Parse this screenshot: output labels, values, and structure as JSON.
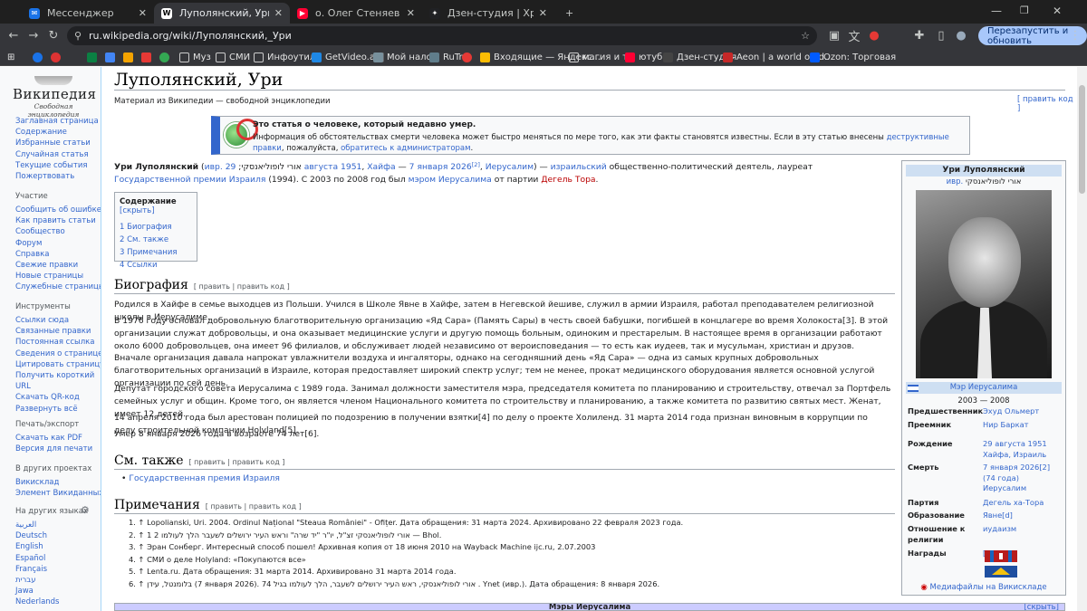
{
  "browser": {
    "tabs": [
      {
        "title": "Мессенджер",
        "favicon_color": "#1a73e8",
        "favicon": "✉"
      },
      {
        "title": "Луполянский, Ури — Википедия",
        "favicon_color": "#ffffff",
        "favicon": "W",
        "active": true
      },
      {
        "title": "о. Олег Стеняев о пятидесятниках",
        "favicon_color": "#ff0033",
        "favicon": "▶"
      },
      {
        "title": "Дзен-студия | Хроники цитадели",
        "favicon_color": "#202124",
        "favicon": "✦"
      }
    ],
    "new_tab": "+",
    "url": "ru.wikipedia.org/wiki/Луполянский,_Ури",
    "relaunch": "Перезапустить и обновить",
    "bookmarks": [
      "Муз",
      "СМИ",
      "Инфоутиль",
      "GetVideo.at |",
      "Мой налог",
      "RuTr",
      "Входящие — Яндекс...",
      "магия и тд",
      "ютуб",
      "Дзен-студия",
      "Aeon | a world of id...",
      "Ozon: Торговая"
    ]
  },
  "sidebar": {
    "logo_name": "Википедия",
    "logo_tag": "Свободная энциклопедия",
    "main": [
      "Заглавная страница",
      "Содержание",
      "Избранные статьи",
      "Случайная статья",
      "Текущие события",
      "Пожертвовать"
    ],
    "participation_h": "Участие",
    "participation": [
      "Сообщить об ошибке",
      "Как править статьи",
      "Сообщество",
      "Форум",
      "Справка",
      "Свежие правки",
      "Новые страницы",
      "Служебные страницы"
    ],
    "tools_h": "Инструменты",
    "tools": [
      "Ссылки сюда",
      "Связанные правки",
      "Постоянная ссылка",
      "Сведения о странице",
      "Цитировать страницу",
      "Получить короткий",
      "URL",
      "Скачать QR-код",
      "Развернуть всё"
    ],
    "print_h": "Печать/экспорт",
    "print": [
      "Скачать как PDF",
      "Версия для печати"
    ],
    "projects_h": "В других проектах",
    "projects": [
      "Викисклад",
      "Элемент Викиданных"
    ],
    "langs_h": "На других языках",
    "langs": [
      "العربية",
      "Deutsch",
      "English",
      "Español",
      "Français",
      "עברית",
      "Jawa",
      "Nederlands"
    ]
  },
  "article": {
    "title": "Луполянский, Ури",
    "sitesub": "Материал из Википедии — свободной энциклопедии",
    "edit_code": "[ править код ]",
    "ambox_title": "Это статья о человеке, который недавно умер.",
    "ambox_text_a": "Информация об обстоятельствах смерти человека может быстро меняться по мере того, как эти факты становятся известны. Если в эту статью внесены ",
    "ambox_link1": "деструктивные правки",
    "ambox_text_b": ", пожалуйста, ",
    "ambox_link2": "обратитесь к администраторам",
    "ambox_text_c": ".",
    "lead": {
      "name": "Ури Луполянский",
      "p1": " (",
      "heb_link": "ивр.",
      "heb": " אורי לופוליאנסקי",
      "p2": "; ",
      "born": "29 августа 1951",
      "p3": ", ",
      "haifa": "Хайфа",
      "p4": " — ",
      "died": "7 января 2026",
      "ref2": "[2]",
      "p5": ", ",
      "jer": "Иерусалим",
      "p6": ") — ",
      "isr": "израильский",
      "p7": " общественно-политический деятель, лауреат ",
      "prize": "Государственной премии Израиля",
      "p8": " (1994). С 2003 по 2008 год был ",
      "mayor": "мэром Иерусалима",
      "p9": " от партии ",
      "party": "Дегель Тора",
      "p10": "."
    },
    "toc": {
      "title": "Содержание",
      "hide": "[скрыть]",
      "items": [
        "1 Биография",
        "2 См. также",
        "3 Примечания",
        "4 Ссылки"
      ]
    },
    "bio_h": "Биография",
    "edit": "[ править | править код ]",
    "bio1": "Родился в Хайфе в семье выходцев из Польши. Учился в Школе Явне в Хайфе, затем в Негевской йешиве, служил в армии Израиля, работал преподавателем религиозной школы в Иерусалиме.",
    "bio2": "В 1976 году основал добровольную благотворительную организацию «Яд Сара» (Память Сары) в честь своей бабушки, погибшей в концлагере во время Холокоста[3]. В этой организации служат добровольцы, и она оказывает медицинские услуги и другую помощь больным, одиноким и престарелым. В настоящее время в организации работают около 6000 добровольцев, она имеет 96 филиалов, и обслуживает людей независимо от вероисповедания — то есть как иудеев, так и мусульман, христиан и друзов. Вначале организация давала напрокат увлажнители воздуха и ингаляторы, однако на сегодняшний день «Яд Сара» — одна из самых крупных добровольных благотворительных организаций в Израиле, которая предоставляет широкий спектр услуг; тем не менее, прокат медицинского оборудования является основной услугой организации по сей день.",
    "bio3": "Депутат городского совета Иерусалима с 1989 года. Занимал должности заместителя мэра, председателя комитета по планированию и строительству, отвечал за Портфель семейных услуг и общин. Кроме того, он является членом Национального комитета по строительству и планированию, а также комитета по развитию святых мест. Женат, имеет 12 детей.",
    "bio4": "14 апреля 2010 года был арестован полицией по подозрению в получении взятки[4] по делу о проекте Холиленд. 31 марта 2014 года признан виновным в коррупции по делу строительной компании Holyland[5].",
    "bio5": "Умер 8 января 2026 года в возрасте 74 лет[6].",
    "see_h": "См. также",
    "see_item": "Государственная премия Израиля",
    "notes_h": "Примечания",
    "refs": [
      "1. ↑ Lopolianski, Uri. 2004. Ordinul Național \"Steaua României\" - Ofițer. Дата обращения: 31 марта 2024. Архивировано 22 февраля 2023 года.",
      "2. ↑ 1 2 אורי לופוליאנסקי זצ\"ל, יו\"ר \"יד שרה\" וראש העיר ירושלים לשעבר הלך לעולמו — Bhol.",
      "3. ↑ Эран Сонберг. Интересный способ пошел! Архивная копия от 18 июня 2010 на Wayback Machine ijc.ru, 2.07.2003",
      "4. ↑ СМИ о деле Holyland: «Покупаются все»",
      "5. ↑ Lenta.ru. Дата обращения: 31 марта 2014. Архивировано 31 марта 2014 года.",
      "6. ↑ בלומנטל, עידן (7 января 2026). 74 אורי לופוליאנסקי, ראש העיר ירושלים לשעבר, הלך לעולמו בגיל . Ynet (ивр.). Дата обращения: 8 января 2026."
    ],
    "nav_bottom": "Мэры Иерусалима",
    "nav_hide": "[скрыть]"
  },
  "infobox": {
    "title": "Ури Луполянский",
    "native_prefix": "ивр.",
    "native": "אורי לופוליאנסקי",
    "office": "Мэр Иерусалима",
    "years": "2003 — 2008",
    "rows": [
      {
        "k": "Предшественник",
        "v": "Эхуд Ольмерт"
      },
      {
        "k": "Преемник",
        "v": "Нир Баркат"
      },
      {
        "k": "Рождение",
        "v": "29 августа 1951\nХайфа, Израиль"
      },
      {
        "k": "Смерть",
        "v": "7 января 2026[2]\n(74 года)\nИерусалим"
      },
      {
        "k": "Партия",
        "v": "Дегель ха-Тора"
      },
      {
        "k": "Образование",
        "v": "Явне[d]"
      },
      {
        "k": "Отношение к религии",
        "v": "иудаизм"
      },
      {
        "k": "Награды",
        "v": "[1]"
      }
    ],
    "media": "Медиафайлы на Викискладе"
  }
}
